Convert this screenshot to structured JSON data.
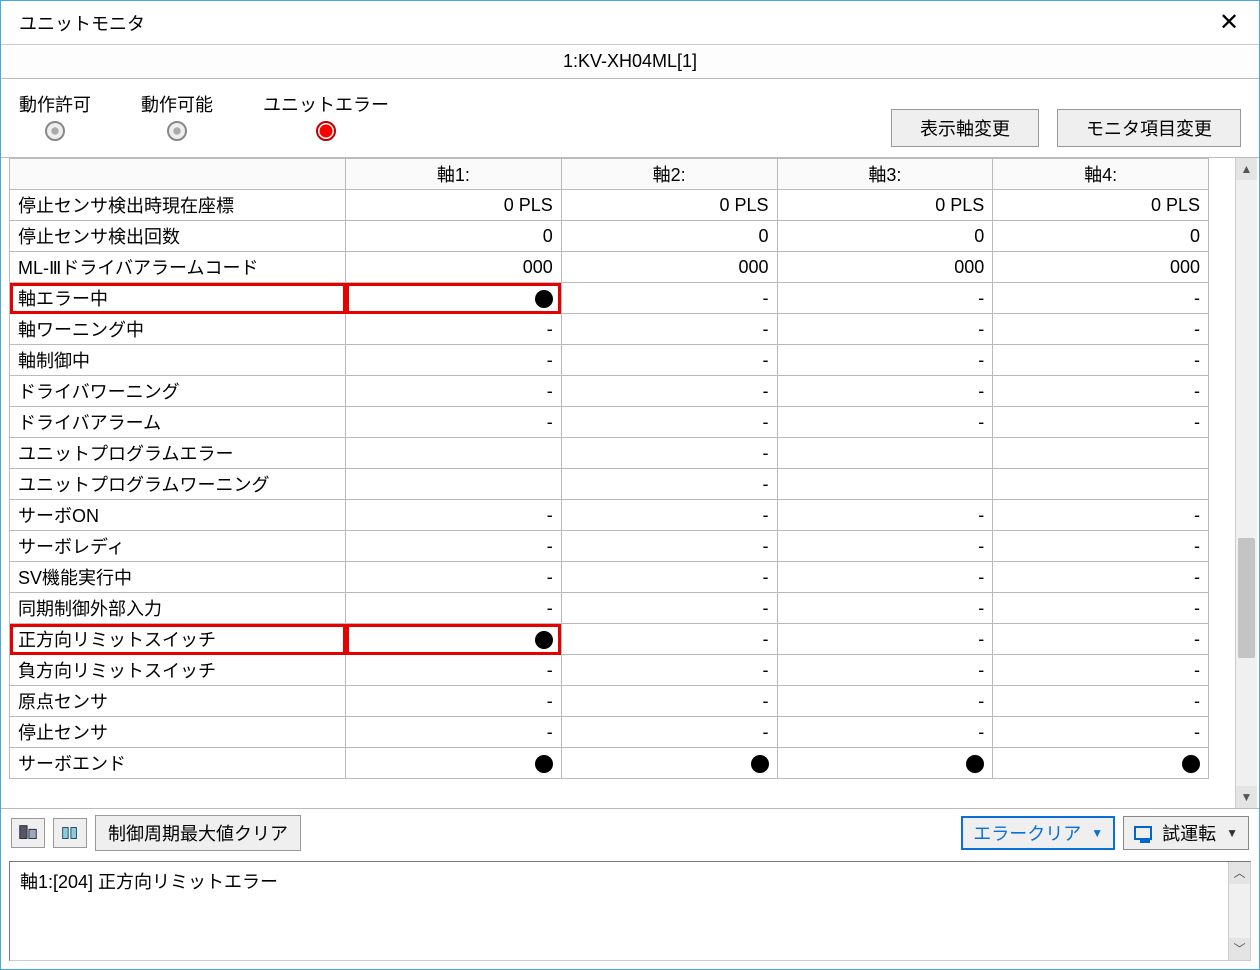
{
  "window": {
    "title": "ユニットモニタ"
  },
  "subtitle": "1:KV-XH04ML[1]",
  "status_indicators": [
    {
      "label": "動作許可",
      "on": false
    },
    {
      "label": "動作可能",
      "on": false
    },
    {
      "label": "ユニットエラー",
      "on": true
    }
  ],
  "toolbar": {
    "change_axis": "表示軸変更",
    "change_items": "モニタ項目変更"
  },
  "columns": [
    "",
    "軸1:",
    "軸2:",
    "軸3:",
    "軸4:"
  ],
  "rows": [
    {
      "label": "停止センサ検出時現在座標",
      "v": [
        "0 PLS",
        "0 PLS",
        "0 PLS",
        "0 PLS"
      ],
      "hl": false
    },
    {
      "label": "停止センサ検出回数",
      "v": [
        "0",
        "0",
        "0",
        "0"
      ],
      "hl": false
    },
    {
      "label": "ML-Ⅲドライバアラームコード",
      "v": [
        "000",
        "000",
        "000",
        "000"
      ],
      "hl": false
    },
    {
      "label": "軸エラー中",
      "v": [
        "●",
        "-",
        "-",
        "-"
      ],
      "hl": true
    },
    {
      "label": "軸ワーニング中",
      "v": [
        "-",
        "-",
        "-",
        "-"
      ],
      "hl": false
    },
    {
      "label": "軸制御中",
      "v": [
        "-",
        "-",
        "-",
        "-"
      ],
      "hl": false
    },
    {
      "label": "ドライバワーニング",
      "v": [
        "-",
        "-",
        "-",
        "-"
      ],
      "hl": false
    },
    {
      "label": "ドライバアラーム",
      "v": [
        "-",
        "-",
        "-",
        "-"
      ],
      "hl": false
    },
    {
      "label": "ユニットプログラムエラー",
      "v": [
        "",
        "-",
        "",
        ""
      ],
      "hl": false
    },
    {
      "label": "ユニットプログラムワーニング",
      "v": [
        "",
        "-",
        "",
        ""
      ],
      "hl": false
    },
    {
      "label": "サーボON",
      "v": [
        "-",
        "-",
        "-",
        "-"
      ],
      "hl": false
    },
    {
      "label": "サーボレディ",
      "v": [
        "-",
        "-",
        "-",
        "-"
      ],
      "hl": false
    },
    {
      "label": "SV機能実行中",
      "v": [
        "-",
        "-",
        "-",
        "-"
      ],
      "hl": false
    },
    {
      "label": "同期制御外部入力",
      "v": [
        "-",
        "-",
        "-",
        "-"
      ],
      "hl": false
    },
    {
      "label": "正方向リミットスイッチ",
      "v": [
        "●",
        "-",
        "-",
        "-"
      ],
      "hl": true
    },
    {
      "label": "負方向リミットスイッチ",
      "v": [
        "-",
        "-",
        "-",
        "-"
      ],
      "hl": false
    },
    {
      "label": "原点センサ",
      "v": [
        "-",
        "-",
        "-",
        "-"
      ],
      "hl": false
    },
    {
      "label": "停止センサ",
      "v": [
        "-",
        "-",
        "-",
        "-"
      ],
      "hl": false
    },
    {
      "label": "サーボエンド",
      "v": [
        "●",
        "●",
        "●",
        "●"
      ],
      "hl": false
    }
  ],
  "bottom": {
    "clear_cycle": "制御周期最大値クリア",
    "error_clear": "エラークリア",
    "trial_run": "試運転"
  },
  "status_message": "軸1:[204] 正方向リミットエラー"
}
